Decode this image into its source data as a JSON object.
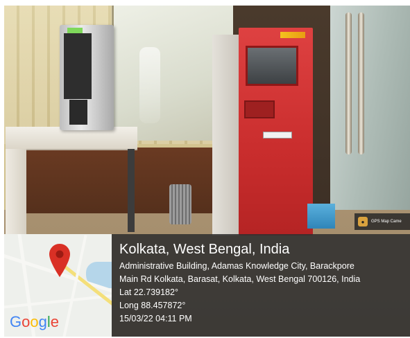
{
  "overlay": {
    "badge": "GPS Map Came",
    "title": "Kolkata, West Bengal, India",
    "address_line1": "Administrative Building, Adamas Knowledge City, Barackpore",
    "address_line2": "Main Rd Kolkata, Barasat, Kolkata, West Bengal 700126, India",
    "latitude": "Lat 22.739182°",
    "longitude": "Long 88.457872°",
    "datetime": "15/03/22 04:11 PM"
  },
  "map": {
    "logo_letters": [
      "G",
      "o",
      "o",
      "g",
      "l",
      "e"
    ],
    "pin_color": "#d93025"
  },
  "colors": {
    "atm_red": "#d23434",
    "overlay_bg": "#303030"
  }
}
